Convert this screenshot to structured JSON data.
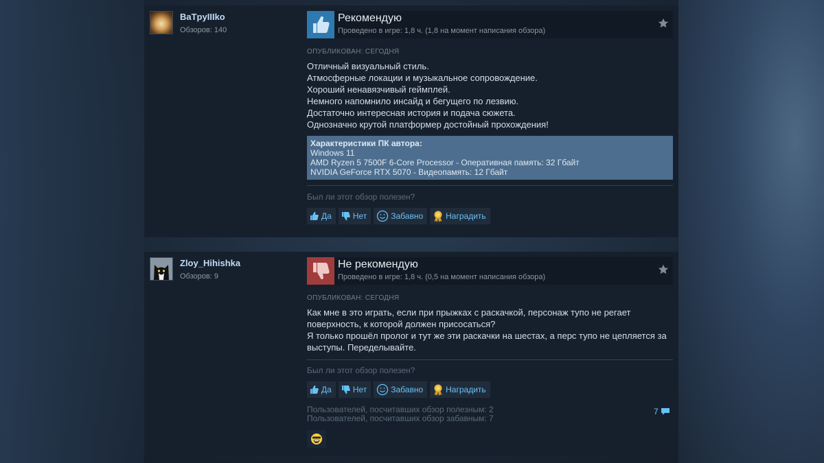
{
  "reviews": [
    {
      "author": {
        "name": "BaTpyIIIko",
        "reviews_count": "Обзоров: 140"
      },
      "verdict": "Рекомендую",
      "playtime": "Проведено в игре: 1,8 ч. (1,8 на момент написания обзора)",
      "posted": "ОПУБЛИКОВАН: СЕГОДНЯ",
      "text_lines": [
        "Отличный визуальный стиль.",
        "Атмосферные локации и музыкальное сопровождение.",
        "Хороший ненавязчивый геймплей.",
        "Немного напомнило инсайд и бегущего по лезвию.",
        "Достаточно интересная история и подача сюжета.",
        "Однозначно крутой платформер достойный прохождения!"
      ],
      "specs": {
        "title": "Характеристики ПК автора:",
        "lines": [
          "Windows 11",
          "AMD Ryzen 5 7500F 6-Core Processor - Оперативная память: 32 Гбайт",
          "NVIDIA GeForce RTX 5070 - Видеопамять: 12 Гбайт"
        ]
      },
      "helpful_question": "Был ли этот обзор полезен?",
      "buttons": {
        "yes": "Да",
        "no": "Нет",
        "funny": "Забавно",
        "award": "Наградить"
      }
    },
    {
      "author": {
        "name": "Zloy_Hihishka",
        "reviews_count": "Обзоров: 9"
      },
      "verdict": "Не рекомендую",
      "playtime": "Проведено в игре: 1,8 ч. (0,5 на момент написания обзора)",
      "posted": "ОПУБЛИКОВАН: СЕГОДНЯ",
      "text_lines": [
        "Как мне в это играть, если при прыжках с раскачкой, персонаж тупо не регает",
        "поверхность, к которой должен присосаться?",
        "Я только прошёл пролог и тут же эти раскачки на шестах, а перс тупо не цепляется за",
        "выступы. Переделывайте."
      ],
      "helpful_question": "Был ли этот обзор полезен?",
      "buttons": {
        "yes": "Да",
        "no": "Нет",
        "funny": "Забавно",
        "award": "Наградить"
      },
      "stats": {
        "helpful": "Пользователей, посчитавших обзор полезным: 2",
        "funny": "Пользователей, посчитавших обзор забавным: 7"
      },
      "comments_count": "7"
    }
  ],
  "colors": {
    "recommend": "#2e7aaf",
    "not_recommend": "#a13c3c",
    "link": "#67c1f5"
  }
}
